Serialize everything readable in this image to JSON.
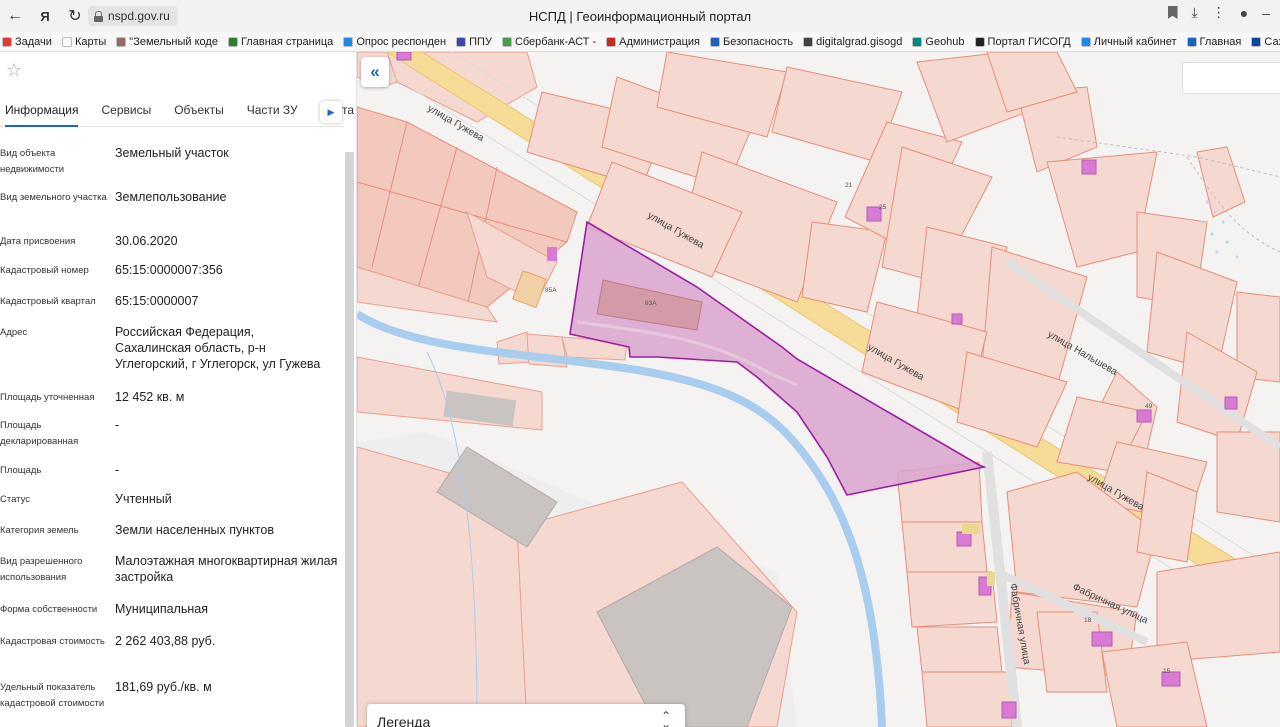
{
  "browser": {
    "url": "nspd.gov.ru",
    "page_title": "НСПД | Геоинформационный портал",
    "bookmarks": [
      {
        "label": "Задачи",
        "color": "#e53935"
      },
      {
        "label": "Карты",
        "color": "#ffffff"
      },
      {
        "label": "\"Земельный коде",
        "color": "#8d6e63"
      },
      {
        "label": "Главная страница",
        "color": "#2e7d32"
      },
      {
        "label": "Опрос респонден",
        "color": "#1e88e5"
      },
      {
        "label": "ППУ",
        "color": "#3949ab"
      },
      {
        "label": "Сбербанк-АСТ -",
        "color": "#43a047"
      },
      {
        "label": "Администрация",
        "color": "#c62828"
      },
      {
        "label": "Безопасность",
        "color": "#1565c0"
      },
      {
        "label": "digitalgrad.gisogd",
        "color": "#424242"
      },
      {
        "label": "Geohub",
        "color": "#00897b"
      },
      {
        "label": "Портал ГИСОГД",
        "color": "#212121"
      },
      {
        "label": "Личный кабинет",
        "color": "#1e88e5"
      },
      {
        "label": "Главная",
        "color": "#1565c0"
      },
      {
        "label": "Сахалин - ИАС Па",
        "color": "#0d47a1"
      }
    ]
  },
  "panel": {
    "tabs": [
      "Информация",
      "Сервисы",
      "Объекты",
      "Части ЗУ",
      "Соста"
    ],
    "rows": [
      {
        "key": "Вид объекта недвижимости",
        "value": "Земельный участок"
      },
      {
        "key": "Вид земельного участка",
        "value": "Землепользование"
      },
      {
        "key": "Дата присвоения",
        "value": "30.06.2020"
      },
      {
        "key": "Кадастровый номер",
        "value": "65:15:0000007:356"
      },
      {
        "key": "Кадастровый квартал",
        "value": "65:15:0000007"
      },
      {
        "key": "Адрес",
        "value": "Российская Федерация, Сахалинская область, р-н Углегорский, г Углегорск, ул Гужева"
      },
      {
        "key": "Площадь уточненная",
        "value": "12 452 кв. м"
      },
      {
        "key": "Площадь декларированная",
        "value": "-"
      },
      {
        "key": "Площадь",
        "value": "-"
      },
      {
        "key": "Статус",
        "value": "Учтенный"
      },
      {
        "key": "Категория земель",
        "value": "Земли населенных пунктов"
      },
      {
        "key": "Вид разрешенного использования",
        "value": "Малоэтажная многоквартирная жилая застройка"
      },
      {
        "key": "Форма собственности",
        "value": "Муниципальная"
      },
      {
        "key": "Кадастровая стоимость",
        "value": "2 262 403,88 руб."
      },
      {
        "key": "Удельный показатель кадастровой стоимости",
        "value": "181,69 руб./кв. м"
      }
    ]
  },
  "map": {
    "streets": [
      "улица Гужева",
      "улица Гужева",
      "улица Гужева",
      "улица Гужева",
      "улица Нальшева",
      "Фабричная улица",
      "Фабричная улица"
    ],
    "house_numbers": [
      "21",
      "25",
      "85А",
      "83А",
      "49",
      "18",
      "15"
    ],
    "legend_label": "Легенда",
    "colors": {
      "parcel_fill": "#f5cfc4",
      "parcel_stroke": "#e98a76",
      "selected_fill": "#d9a4cf",
      "selected_stroke": "#9a1fa0",
      "road": "#f7dc98",
      "river": "#a9cdee"
    }
  }
}
